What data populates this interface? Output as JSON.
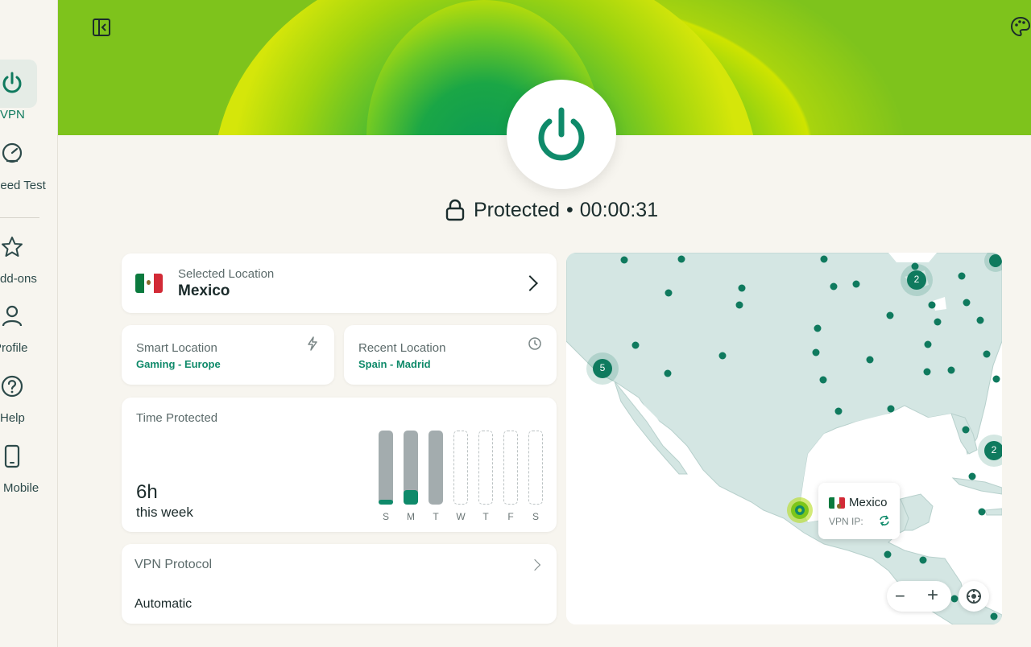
{
  "sidebar": {
    "items": [
      {
        "label": "VPN",
        "icon": "power-icon",
        "active": true
      },
      {
        "label": "Speed Test",
        "icon": "speedometer-icon"
      },
      {
        "label": "Add-ons",
        "icon": "star-icon"
      },
      {
        "label": "Profile",
        "icon": "user-icon"
      },
      {
        "label": "Help",
        "icon": "help-icon"
      },
      {
        "label": "Mobile",
        "icon": "mobile-icon"
      }
    ]
  },
  "status": {
    "state": "Protected",
    "separator": "•",
    "timer": "00:00:31"
  },
  "selected_location": {
    "caption": "Selected Location",
    "country": "Mexico"
  },
  "smart_location": {
    "caption": "Smart Location",
    "value": "Gaming - Europe"
  },
  "recent_location": {
    "caption": "Recent Location",
    "value": "Spain - Madrid"
  },
  "time_protected": {
    "caption": "Time Protected",
    "amount": "6h",
    "period": "this week",
    "days": [
      {
        "label": "S",
        "used": true,
        "fraction": 0.07
      },
      {
        "label": "M",
        "used": true,
        "fraction": 0.2
      },
      {
        "label": "T",
        "used": true,
        "fraction": 0.0
      },
      {
        "label": "W",
        "used": false
      },
      {
        "label": "T",
        "used": false
      },
      {
        "label": "F",
        "used": false
      },
      {
        "label": "S",
        "used": false
      }
    ]
  },
  "vpn_protocol": {
    "caption": "VPN Protocol",
    "value": "Automatic"
  },
  "map": {
    "popup_country": "Mexico",
    "popup_ip_label": "VPN IP:",
    "clusters": [
      "5",
      "2",
      "2"
    ],
    "zoom_out": "−",
    "zoom_in": "+"
  },
  "colors": {
    "accent": "#0f8a6a",
    "hero_green": "#16a34a",
    "hero_yellow": "#cfe400"
  }
}
